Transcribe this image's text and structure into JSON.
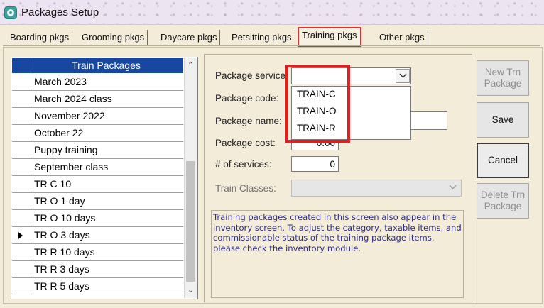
{
  "window": {
    "title": "Packages Setup"
  },
  "tabs": [
    {
      "label": "Boarding pkgs",
      "active": false
    },
    {
      "label": "Grooming pkgs",
      "active": false
    },
    {
      "label": "Daycare pkgs",
      "active": false
    },
    {
      "label": "Petsitting pkgs",
      "active": false
    },
    {
      "label": "Training pkgs",
      "active": true
    },
    {
      "label": "Other pkgs",
      "active": false
    }
  ],
  "grid": {
    "header": "Train Packages",
    "rows": [
      "March 2023",
      "March 2024 class",
      "November 2022",
      "October 22",
      "Puppy training",
      "September class",
      "TR C 10",
      "TR O 1 day",
      "TR O 10 days",
      "TR O 3 days",
      "TR R 10 days",
      "TR R 3 days",
      "TR R 5 days"
    ],
    "current_row": "TR O 3 days"
  },
  "form": {
    "package_service_label": "Package service:",
    "package_service_value": "",
    "package_service_options": [
      "TRAIN-C",
      "TRAIN-O",
      "TRAIN-R"
    ],
    "package_code_label": "Package code:",
    "package_name_label": "Package name:",
    "package_cost_label": "Package cost:",
    "package_cost_value": "0.00",
    "num_services_label": "# of services:",
    "num_services_value": "0",
    "train_classes_label": "Train Classes:",
    "info_text": "Training packages created in this screen also appear in the inventory screen. To adjust the category, taxable items, and commissionable status of the training package items, please check the inventory module."
  },
  "buttons": {
    "new_trn_package": "New Trn Package",
    "save": "Save",
    "cancel": "Cancel",
    "delete_trn_package": "Delete Trn Package"
  },
  "colors": {
    "grid_header": "#17479e",
    "highlight": "#e02020",
    "info_text": "#2c2c8a",
    "background": "#f3ecd9"
  }
}
